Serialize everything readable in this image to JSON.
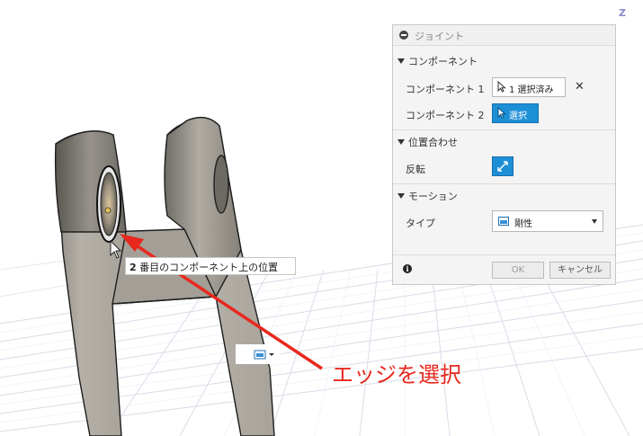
{
  "joint_panel": {
    "title": "ジョイント",
    "sections": {
      "components": "コンポーネント",
      "alignment": "位置合わせ",
      "motion": "モーション"
    },
    "component1": {
      "label": "コンポーネント 1",
      "value": "1 選択済み"
    },
    "component2": {
      "label": "コンポーネント 2",
      "value": "選択"
    },
    "flip": {
      "label": "反転"
    },
    "type": {
      "label": "タイプ",
      "value": "剛性"
    },
    "ok_label": "OK",
    "cancel_label": "キャンセル"
  },
  "tooltip": {
    "number": "2",
    "text": "番目のコンポーネント上の位置"
  },
  "annotation": "エッジを選択",
  "viewcube_letter": "Z",
  "colors": {
    "accent": "#1d8fd6",
    "annotation": "#e8281e"
  },
  "icons": [
    "arrow-cursor-icon",
    "close-icon",
    "flip-icon",
    "rigid-joint-icon",
    "info-icon"
  ]
}
